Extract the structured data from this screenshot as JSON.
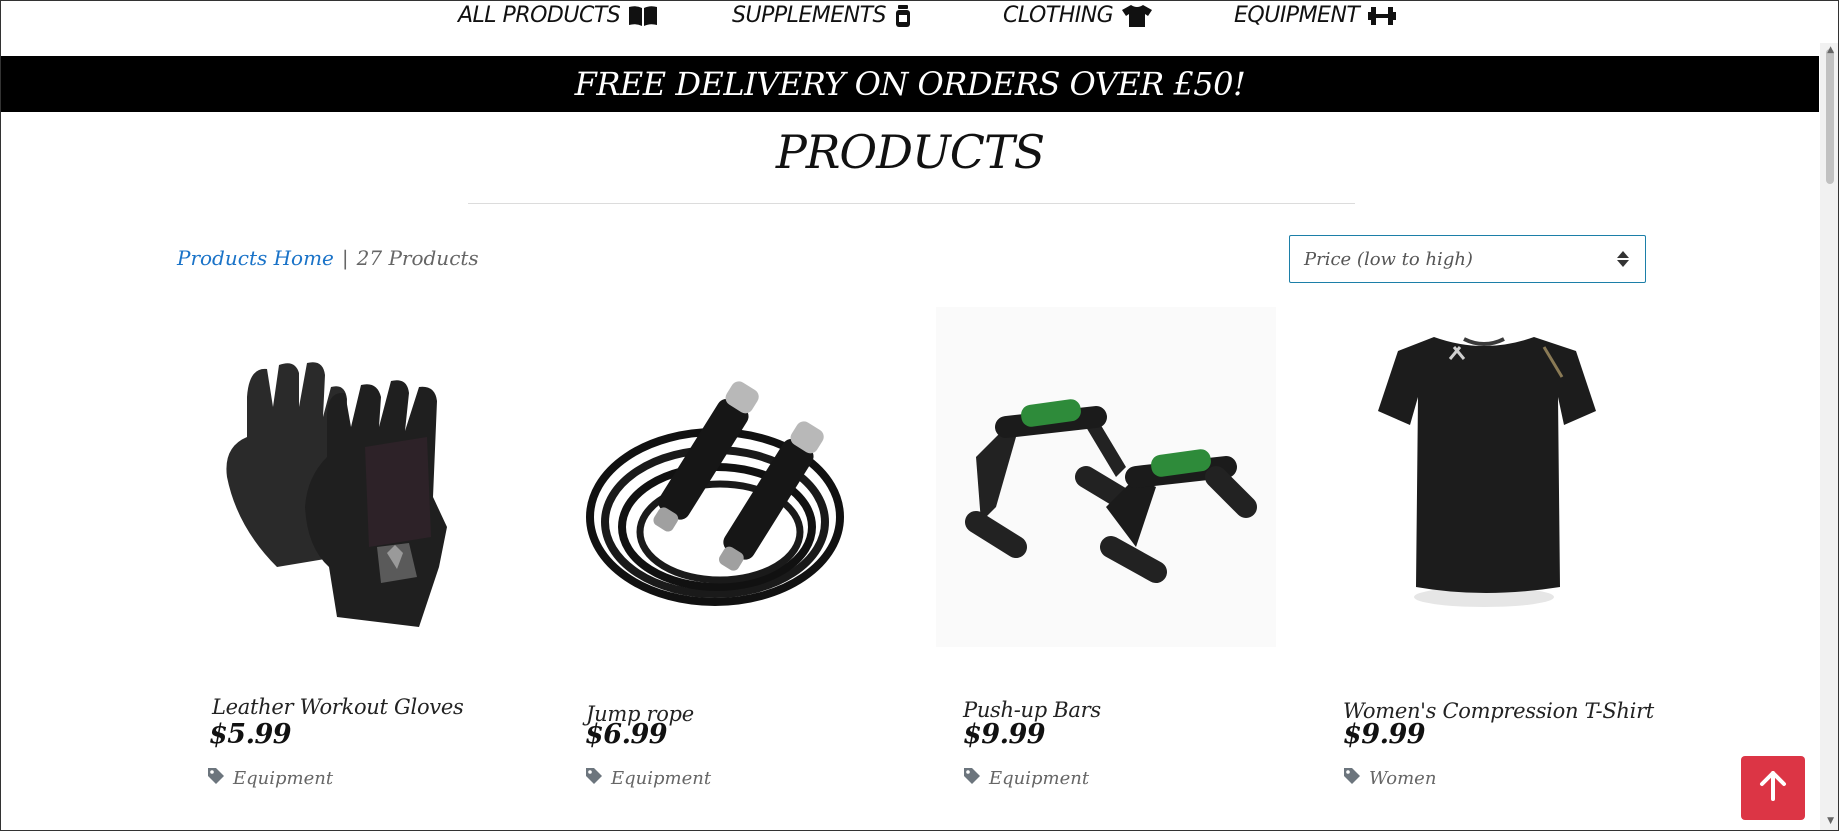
{
  "nav": {
    "items": [
      {
        "label": "ALL PRODUCTS",
        "icon": "book-open-icon"
      },
      {
        "label": "SUPPLEMENTS",
        "icon": "jar-icon"
      },
      {
        "label": "CLOTHING",
        "icon": "tshirt-icon"
      },
      {
        "label": "EQUIPMENT",
        "icon": "dumbbell-icon"
      }
    ]
  },
  "banner": {
    "text": "FREE DELIVERY ON ORDERS OVER £50!"
  },
  "page": {
    "title": "PRODUCTS"
  },
  "breadcrumb": {
    "home_link": "Products Home",
    "separator": "|",
    "count": "27 Products"
  },
  "sort": {
    "selected": "Price (low to high)"
  },
  "products": [
    {
      "name": "Leather Workout Gloves",
      "price": "$5.99",
      "category": "Equipment",
      "image": "gloves-image"
    },
    {
      "name": "Jump rope",
      "price": "$6.99",
      "category": "Equipment",
      "image": "jump-rope-image"
    },
    {
      "name": "Push-up Bars",
      "price": "$9.99",
      "category": "Equipment",
      "image": "push-up-bars-image"
    },
    {
      "name": "Women's Compression T-Shirt",
      "price": "$9.99",
      "category": "Women",
      "image": "tshirt-image"
    }
  ],
  "colors": {
    "accent_link": "#1a73c8",
    "banner_bg": "#000000",
    "back_to_top": "#dc3545",
    "select_border": "#1c7fa8"
  }
}
